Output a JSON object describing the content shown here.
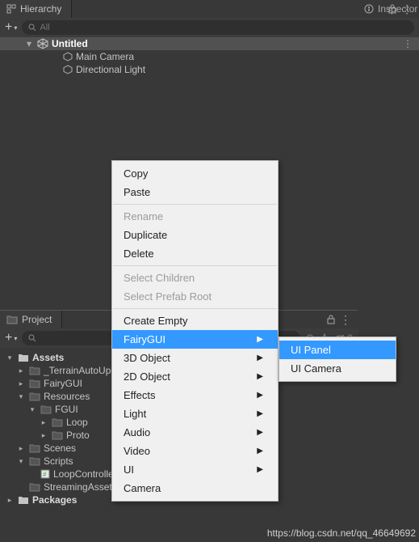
{
  "hierarchy": {
    "tab_label": "Hierarchy",
    "search_placeholder": "All",
    "root": {
      "label": "Untitled"
    },
    "children": [
      {
        "label": "Main Camera"
      },
      {
        "label": "Directional Light"
      }
    ]
  },
  "inspector": {
    "tab_label": "Inspector"
  },
  "project": {
    "tab_label": "Project",
    "hidden_count": "8",
    "tree": {
      "root_a": "Assets",
      "terrain": "_TerrainAutoUpgrade",
      "fairygui": "FairyGUI",
      "resources": "Resources",
      "fgui": "FGUI",
      "loop": "Loop",
      "proto": "Proto",
      "scenes": "Scenes",
      "scripts": "Scripts",
      "loopc": "LoopController",
      "streaming": "StreamingAssets",
      "packages": "Packages"
    }
  },
  "ctx": {
    "copy": "Copy",
    "paste": "Paste",
    "rename": "Rename",
    "duplicate": "Duplicate",
    "delete": "Delete",
    "select_children": "Select Children",
    "select_prefab_root": "Select Prefab Root",
    "create_empty": "Create Empty",
    "fairygui": "FairyGUI",
    "3d_object": "3D Object",
    "2d_object": "2D Object",
    "effects": "Effects",
    "light": "Light",
    "audio": "Audio",
    "video": "Video",
    "ui": "UI",
    "camera": "Camera"
  },
  "sub": {
    "ui_panel": "UI Panel",
    "ui_camera": "UI Camera"
  },
  "watermark": "https://blog.csdn.net/qq_46649692"
}
